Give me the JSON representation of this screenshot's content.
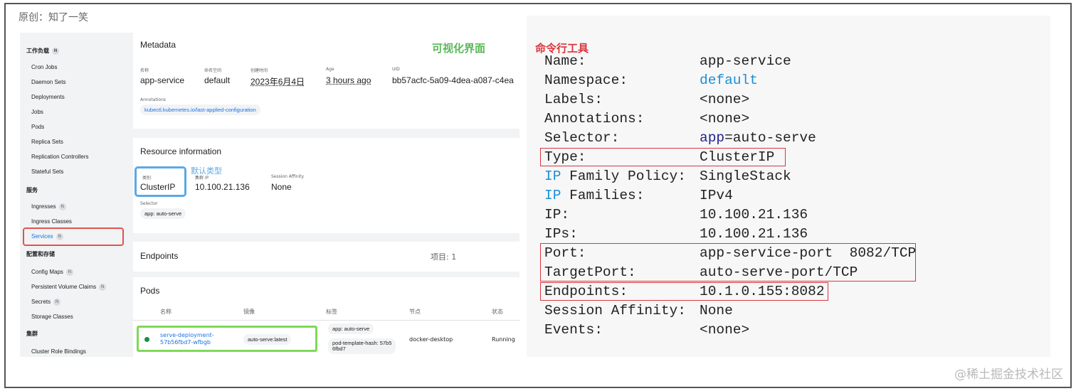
{
  "header": {
    "origin": "原创：知了一笑"
  },
  "sidebar": {
    "sections": [
      {
        "label": "工作负载",
        "badge": "N"
      },
      {
        "label": "服务"
      },
      {
        "label": "配置和存储"
      },
      {
        "label": "集群"
      }
    ],
    "workloads": [
      "Cron Jobs",
      "Daemon Sets",
      "Deployments",
      "Jobs",
      "Pods",
      "Replica Sets",
      "Replication Controllers",
      "Stateful Sets"
    ],
    "service": [
      {
        "label": "Ingresses",
        "badge": "N"
      },
      {
        "label": "Ingress Classes"
      },
      {
        "label": "Services",
        "badge": "N"
      }
    ],
    "config": [
      {
        "label": "Config Maps",
        "badge": "N"
      },
      {
        "label": "Persistent Volume Claims",
        "badge": "N"
      },
      {
        "label": "Secrets",
        "badge": "N"
      },
      {
        "label": "Storage Classes"
      }
    ],
    "cluster": [
      "Cluster Role Bindings"
    ]
  },
  "gui_title": "可视化界面",
  "metadata": {
    "title": "Metadata",
    "name_label": "名称",
    "name": "app-service",
    "ns_label": "命名空间",
    "ns": "default",
    "created_label": "创建时间",
    "created": "2023年6月4日",
    "age_label": "Age",
    "age": "3 hours ago",
    "uid_label": "UID",
    "uid": "bb57acfc-5a09-4dea-a087-c4ea",
    "annotations_label": "Annotations",
    "annotation_chip": "kubectl.kubernetes.io/last-applied-configuration"
  },
  "resource": {
    "title": "Resource information",
    "type_label": "类别",
    "type": "ClusterIP",
    "note": "默认类型",
    "ip_label": "集群 IP",
    "ip": "10.100.21.136",
    "affinity_label": "Session Affinity",
    "affinity": "None",
    "selector_label": "Selector",
    "selector_chip": "app: auto-serve"
  },
  "endpoints": {
    "title": "Endpoints",
    "items": "项目: 1"
  },
  "pods": {
    "title": "Pods",
    "headers": [
      "名称",
      "镜像",
      "标签",
      "节点",
      "状态"
    ],
    "row": {
      "name_line1": "serve-deployment-",
      "name_line2": "57b56fbd7-wfbgb",
      "image": "auto-serve:latest",
      "label1": "app: auto-serve",
      "label2_line1": "pod-template-hash: 57b5",
      "label2_line2": "6fbd7",
      "node": "docker-desktop",
      "status": "Running"
    }
  },
  "cli": {
    "title": "命令行工具",
    "rows": [
      {
        "key": "Name:",
        "value": "app-service"
      },
      {
        "key": "Namespace:",
        "value": "default"
      },
      {
        "key": "Labels:",
        "value": "<none>"
      },
      {
        "key": "Annotations:",
        "value": "<none>"
      },
      {
        "key": "Selector:",
        "vpre": "app",
        "vpost": "=auto-serve"
      },
      {
        "key": "Type:",
        "value": "ClusterIP"
      },
      {
        "kpre": "IP",
        "kpost": " Family Policy:",
        "value": "SingleStack"
      },
      {
        "kpre": "IP",
        "kpost": " Families:",
        "value": "IPv4"
      },
      {
        "key": "IP:",
        "value": "10.100.21.136"
      },
      {
        "key": "IPs:",
        "value": "10.100.21.136"
      },
      {
        "key": "Port:",
        "value": "app-service-port  8082/TCP"
      },
      {
        "key": "TargetPort:",
        "value": "auto-serve-port/TCP"
      },
      {
        "key": "Endpoints:",
        "value": "10.1.0.155:8082"
      },
      {
        "key": "Session Affinity:",
        "value": "None"
      },
      {
        "key": "Events:",
        "value": "<none>"
      }
    ]
  },
  "watermark": "@稀土掘金技术社区",
  "colors": {
    "gui_title": "#5cb85c",
    "cli_title": "#d9363e",
    "highlight_red": "#d9363e",
    "highlight_blue": "#5aa9e6",
    "highlight_green": "#7ed957",
    "running_dot": "#1e8e3e"
  }
}
